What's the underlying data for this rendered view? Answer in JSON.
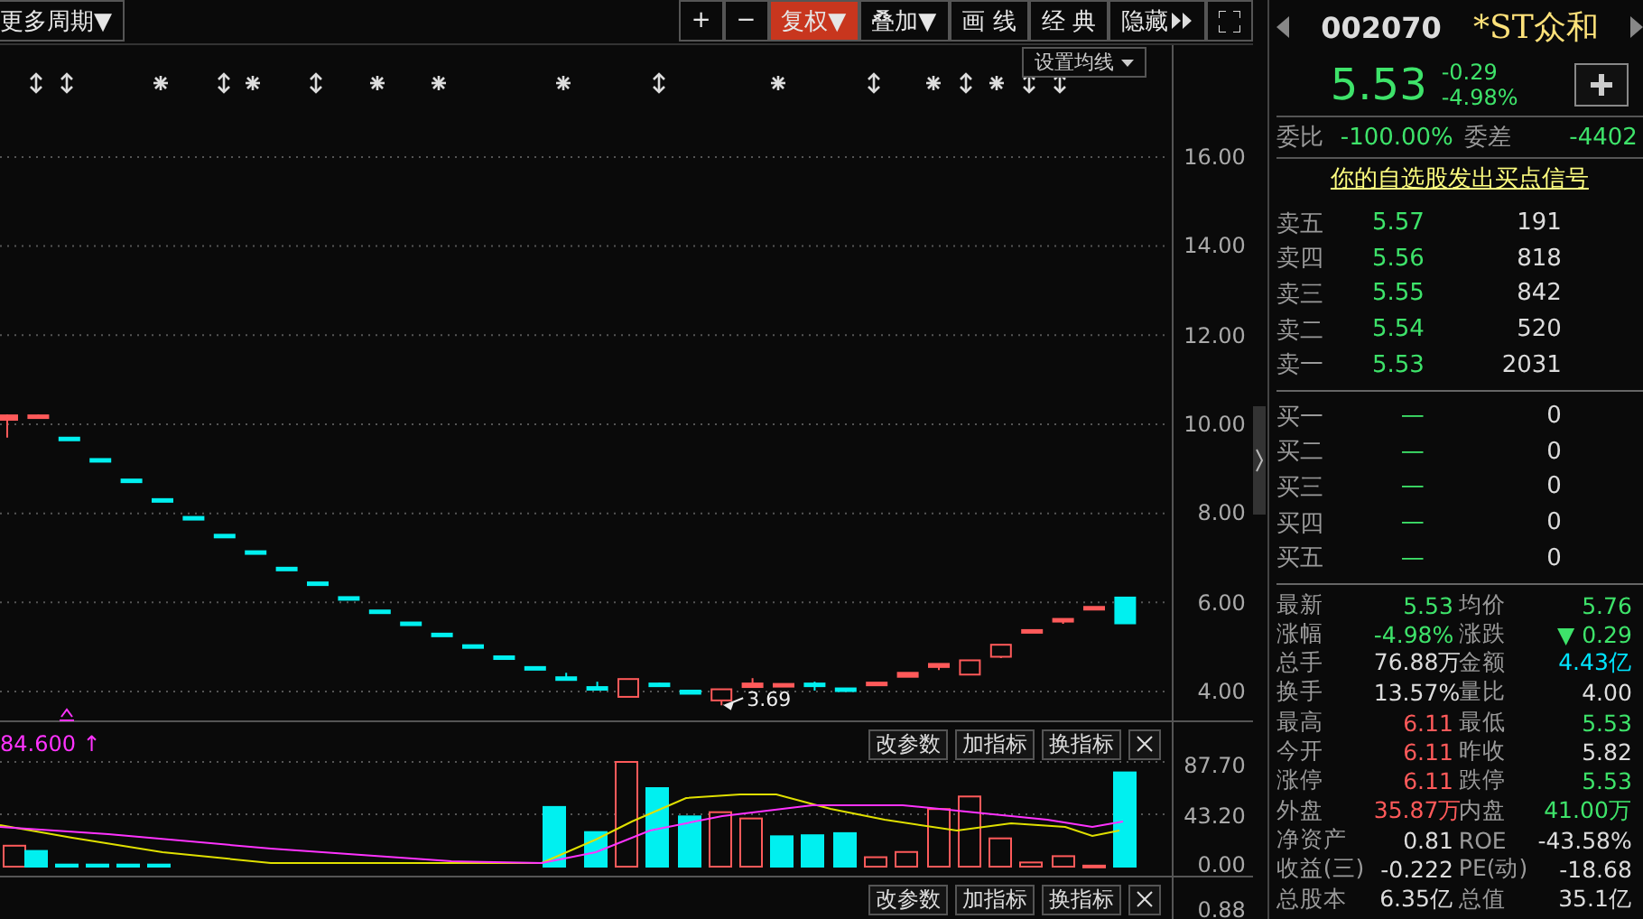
{
  "toolbar": {
    "period_button": "更多周期▼",
    "buttons": [
      {
        "kind": "text",
        "label": "+",
        "selected": false
      },
      {
        "kind": "text",
        "label": "−",
        "selected": false
      },
      {
        "kind": "text",
        "label": "复权▼",
        "selected": true
      },
      {
        "kind": "text",
        "label": "叠加▼",
        "selected": false
      },
      {
        "kind": "text",
        "label": "画 线",
        "selected": false
      },
      {
        "kind": "text",
        "label": "经 典",
        "selected": false
      },
      {
        "kind": "hide",
        "label": "隐藏",
        "selected": false
      },
      {
        "kind": "fullscreen",
        "selected": false
      }
    ]
  },
  "price_chart": {
    "ma_button": "设置均线",
    "y_ticks": [
      "16.00",
      "14.00",
      "12.00",
      "10.00",
      "8.00",
      "6.00",
      "4.00"
    ],
    "low_label": "3.69"
  },
  "volume_panel": {
    "reading": "84.600 ↑",
    "buttons": [
      "改参数",
      "加指标",
      "换指标"
    ],
    "y_ticks": [
      "87.70",
      "43.20",
      "0.00"
    ]
  },
  "indicator_panel": {
    "buttons": [
      "改参数",
      "加指标",
      "换指标"
    ],
    "y_ticks": [
      "0.88"
    ]
  },
  "quote": {
    "code": "002070",
    "name": "*ST众和",
    "price": "5.53",
    "change": "-0.29",
    "change_pct": "-4.98%"
  },
  "order_ratio": {
    "ratio_label": "委比",
    "ratio": "-100.00%",
    "diff_label": "委差",
    "diff": "-4402"
  },
  "signal_link": "你的自选股发出买点信号",
  "asks": [
    {
      "label": "卖五",
      "price": "5.57",
      "volume": "191"
    },
    {
      "label": "卖四",
      "price": "5.56",
      "volume": "818"
    },
    {
      "label": "卖三",
      "price": "5.55",
      "volume": "842"
    },
    {
      "label": "卖二",
      "price": "5.54",
      "volume": "520"
    },
    {
      "label": "卖一",
      "price": "5.53",
      "volume": "2031"
    }
  ],
  "bids": [
    {
      "label": "买一",
      "price": "—",
      "volume": "0"
    },
    {
      "label": "买二",
      "price": "—",
      "volume": "0"
    },
    {
      "label": "买三",
      "price": "—",
      "volume": "0"
    },
    {
      "label": "买四",
      "price": "—",
      "volume": "0"
    },
    {
      "label": "买五",
      "price": "—",
      "volume": "0"
    }
  ],
  "stats": [
    {
      "cells": [
        {
          "label": "最新",
          "value": "5.53",
          "color": "#3ee36a"
        },
        {
          "label": "均价",
          "value": "5.76",
          "color": "#3ee36a"
        }
      ]
    },
    {
      "cells": [
        {
          "label": "涨幅",
          "value": "-4.98%",
          "color": "#3ee36a"
        },
        {
          "label": "涨跌",
          "value": "▼ 0.29",
          "color": "#3ee36a"
        }
      ]
    },
    {
      "cells": [
        {
          "label": "总手",
          "value": "76.88万",
          "color": "#dcdcdc"
        },
        {
          "label": "金额",
          "value": "4.43亿",
          "color": "#00e5ff"
        }
      ]
    },
    {
      "cells": [
        {
          "label": "换手",
          "value": "13.57%",
          "color": "#dcdcdc"
        },
        {
          "label": "量比",
          "value": "4.00",
          "color": "#dcdcdc"
        }
      ]
    },
    {
      "cells": [
        {
          "label": "最高",
          "value": "6.11",
          "color": "#ff5a5a"
        },
        {
          "label": "最低",
          "value": "5.53",
          "color": "#3ee36a"
        }
      ]
    },
    {
      "cells": [
        {
          "label": "今开",
          "value": "6.11",
          "color": "#ff5a5a"
        },
        {
          "label": "昨收",
          "value": "5.82",
          "color": "#dcdcdc"
        }
      ]
    },
    {
      "cells": [
        {
          "label": "涨停",
          "value": "6.11",
          "color": "#ff5a5a"
        },
        {
          "label": "跌停",
          "value": "5.53",
          "color": "#3ee36a"
        }
      ]
    },
    {
      "cells": [
        {
          "label": "外盘",
          "value": "35.87万",
          "color": "#ff5a5a"
        },
        {
          "label": "内盘",
          "value": "41.00万",
          "color": "#3ee36a"
        }
      ]
    },
    {
      "cells": [
        {
          "label": "净资产",
          "value": "0.81",
          "color": "#dcdcdc"
        },
        {
          "label": "ROE",
          "value": "-43.58%",
          "color": "#dcdcdc"
        }
      ]
    },
    {
      "cells": [
        {
          "label": "收益(三)",
          "value": "-0.222",
          "color": "#dcdcdc"
        },
        {
          "label": "PE(动)",
          "value": "-18.68",
          "color": "#dcdcdc"
        }
      ]
    },
    {
      "cells": [
        {
          "label": "总股本",
          "value": "6.35亿",
          "color": "#dcdcdc"
        },
        {
          "label": "总值",
          "value": "35.1亿",
          "color": "#dcdcdc"
        }
      ]
    }
  ]
}
